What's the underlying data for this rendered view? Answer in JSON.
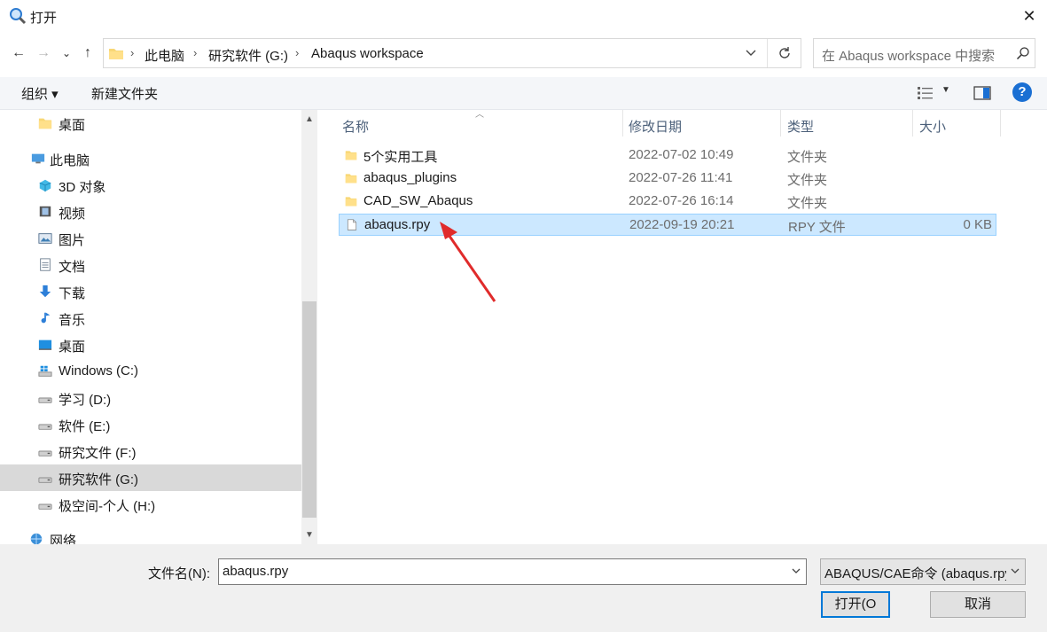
{
  "window": {
    "title": "打开",
    "close_glyph": "✕"
  },
  "nav": {
    "back": "←",
    "forward": "→",
    "recent": "⌄",
    "up": "↑"
  },
  "breadcrumb": [
    "此电脑",
    "研究软件 (G:)",
    "Abaqus workspace"
  ],
  "breadcrumb_sep": "›",
  "search": {
    "placeholder": "在 Abaqus workspace 中搜索"
  },
  "toolbar": {
    "organize": "组织 ▾",
    "new_folder": "新建文件夹",
    "help": "?",
    "view_caret": "▼"
  },
  "sidebar": {
    "items": [
      {
        "label": "桌面",
        "icon": "folder-icon"
      },
      {
        "label": "此电脑",
        "icon": "pc-icon"
      },
      {
        "label": "3D 对象",
        "icon": "3d-icon"
      },
      {
        "label": "视频",
        "icon": "video-icon"
      },
      {
        "label": "图片",
        "icon": "picture-icon"
      },
      {
        "label": "文档",
        "icon": "document-icon"
      },
      {
        "label": "下载",
        "icon": "download-icon"
      },
      {
        "label": "音乐",
        "icon": "music-icon"
      },
      {
        "label": "桌面",
        "icon": "desktop-icon"
      },
      {
        "label": "Windows (C:)",
        "icon": "windows-drive-icon"
      },
      {
        "label": "学习 (D:)",
        "icon": "drive-icon"
      },
      {
        "label": "软件 (E:)",
        "icon": "drive-icon"
      },
      {
        "label": "研究文件 (F:)",
        "icon": "drive-icon"
      },
      {
        "label": "研究软件 (G:)",
        "icon": "drive-icon",
        "selected": true
      },
      {
        "label": "极空间-个人 (H:)",
        "icon": "drive-icon"
      },
      {
        "label": "网络",
        "icon": "network-icon"
      }
    ]
  },
  "list": {
    "columns": [
      "名称",
      "修改日期",
      "类型",
      "大小"
    ],
    "rows": [
      {
        "name": "5个实用工具",
        "date": "2022-07-02 10:49",
        "type": "文件夹",
        "size": "",
        "kind": "folder"
      },
      {
        "name": "abaqus_plugins",
        "date": "2022-07-26 11:41",
        "type": "文件夹",
        "size": "",
        "kind": "folder"
      },
      {
        "name": "CAD_SW_Abaqus",
        "date": "2022-07-26 16:14",
        "type": "文件夹",
        "size": "",
        "kind": "folder"
      },
      {
        "name": "abaqus.rpy",
        "date": "2022-09-19 20:21",
        "type": "RPY 文件",
        "size": "0 KB",
        "kind": "file",
        "selected": true
      }
    ]
  },
  "bottom": {
    "filename_label": "文件名(N):",
    "filename_value": "abaqus.rpy",
    "filter_value": "ABAQUS/CAE命令 (abaqus.rpy)",
    "open_label": "打开(O",
    "cancel_label": "取消"
  },
  "colors": {
    "accent": "#0078d7",
    "selection": "#cce8ff",
    "arrow": "#e02b2b"
  }
}
